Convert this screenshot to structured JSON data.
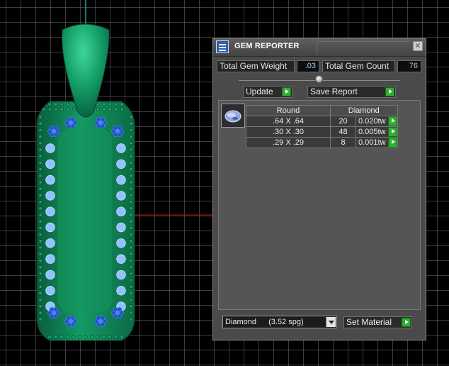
{
  "window": {
    "title": "GEM REPORTER",
    "close_glyph": "✕"
  },
  "summary": {
    "weight_label": "Total Gem Weight",
    "weight_value": ".03",
    "count_label": "Total Gem Count",
    "count_value": "76"
  },
  "actions": {
    "update_label": "Update",
    "save_label": "Save Report"
  },
  "table": {
    "headers": [
      "Round",
      "Diamond"
    ],
    "rows": [
      {
        "size": ".64 X .64",
        "count": "20",
        "weight": "0.020tw"
      },
      {
        "size": ".30 X .30",
        "count": "48",
        "weight": "0.005tw"
      },
      {
        "size": ".29 X .29",
        "count": "8",
        "weight": "0.001tw"
      }
    ]
  },
  "material": {
    "selected_name": "Diamond",
    "selected_density": "(3.52 spg)",
    "set_label": "Set Material"
  },
  "colors": {
    "accent_green": "#2fae2f",
    "pendant": "#0f8a5a",
    "value_text": "#9bd5ff",
    "axis_x": "#b01515",
    "axis_y": "#1aa7a7"
  },
  "icons": {
    "panel": "gem-reporter-icon",
    "thumbnail": "round-gem-icon",
    "go": "green-arrow-icon",
    "dropdown": "chevron-down-icon"
  }
}
